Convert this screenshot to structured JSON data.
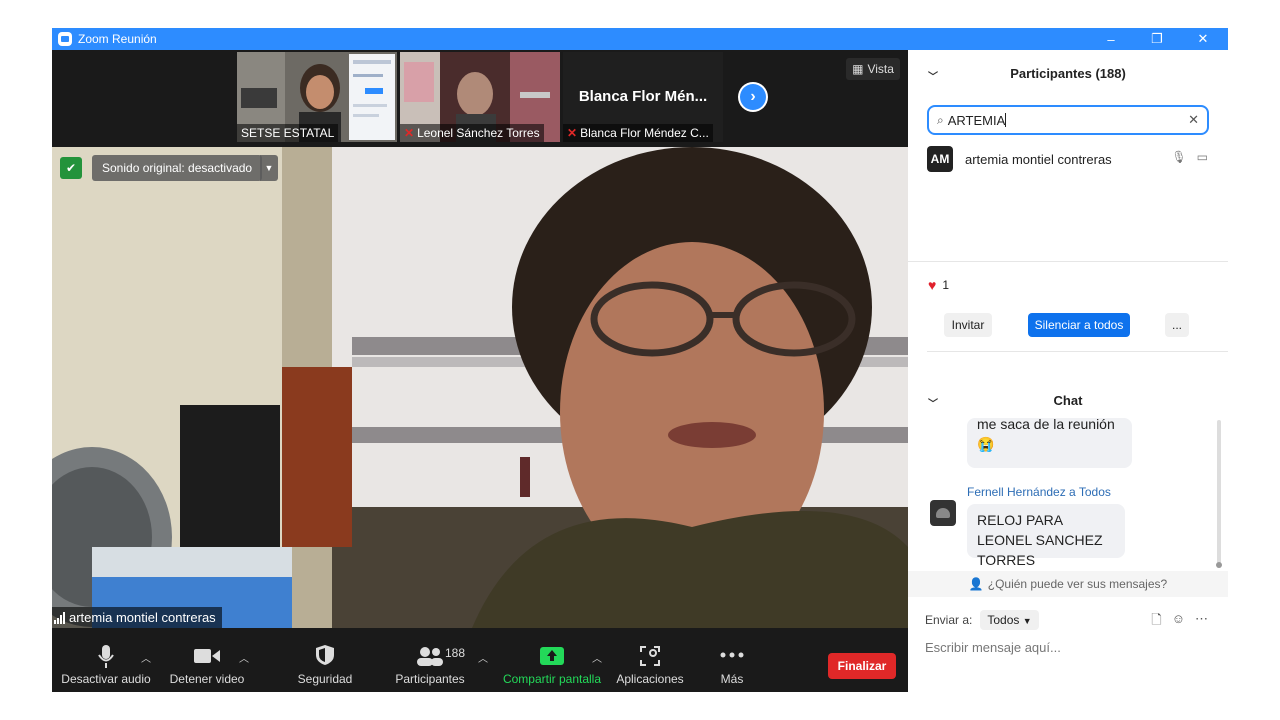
{
  "window": {
    "title": "Zoom Reunión",
    "controls": [
      "–",
      "❐",
      "✕"
    ]
  },
  "thumbnails": [
    {
      "name": "SETSE ESTATAL",
      "muted": false
    },
    {
      "name": "Leonel Sánchez Torres",
      "muted": true
    },
    {
      "name": "Blanca Flor Méndez C...",
      "big_label": "Blanca Flor Mén...",
      "muted": true
    }
  ],
  "view_button": {
    "label": "Vista",
    "icon": "grid-icon"
  },
  "main_video": {
    "speaker_name": "artemia montiel contreras",
    "sound_button": "Sonido original: desactivado"
  },
  "toolbar": {
    "items": [
      {
        "label": "Desactivar audio",
        "icon": "microphone-icon"
      },
      {
        "label": "Detener video",
        "icon": "video-camera-icon"
      },
      {
        "label": "Seguridad",
        "icon": "shield-icon"
      },
      {
        "label": "Participantes",
        "icon": "participants-icon",
        "count": "188"
      },
      {
        "label": "Compartir pantalla",
        "icon": "share-screen-icon"
      },
      {
        "label": "Aplicaciones",
        "icon": "apps-icon"
      },
      {
        "label": "Más",
        "icon": "more-icon"
      }
    ],
    "end_button": "Finalizar",
    "colors": {
      "share": "#23d959",
      "end": "#e02828"
    }
  },
  "participants_panel": {
    "title": "Participantes (188)",
    "search_value": "ARTEMIA",
    "results": [
      {
        "initials": "AM",
        "name": "artemia montiel contreras"
      }
    ],
    "reaction_count": "1",
    "invite_label": "Invitar",
    "mute_all_label": "Silenciar a todos",
    "more_label": "..."
  },
  "chat": {
    "title": "Chat",
    "messages": [
      {
        "text": "me saca de la reunión",
        "emoji": "😭"
      },
      {
        "sender": "Fernell Hernández a Todos",
        "text": "RELOJ PARA LEONEL SANCHEZ TORRES"
      }
    ],
    "who_can_see": "¿Quién puede ver sus mensajes?",
    "send_to_label": "Enviar a:",
    "send_to_value": "Todos",
    "input_placeholder": "Escribir mensaje aquí..."
  }
}
